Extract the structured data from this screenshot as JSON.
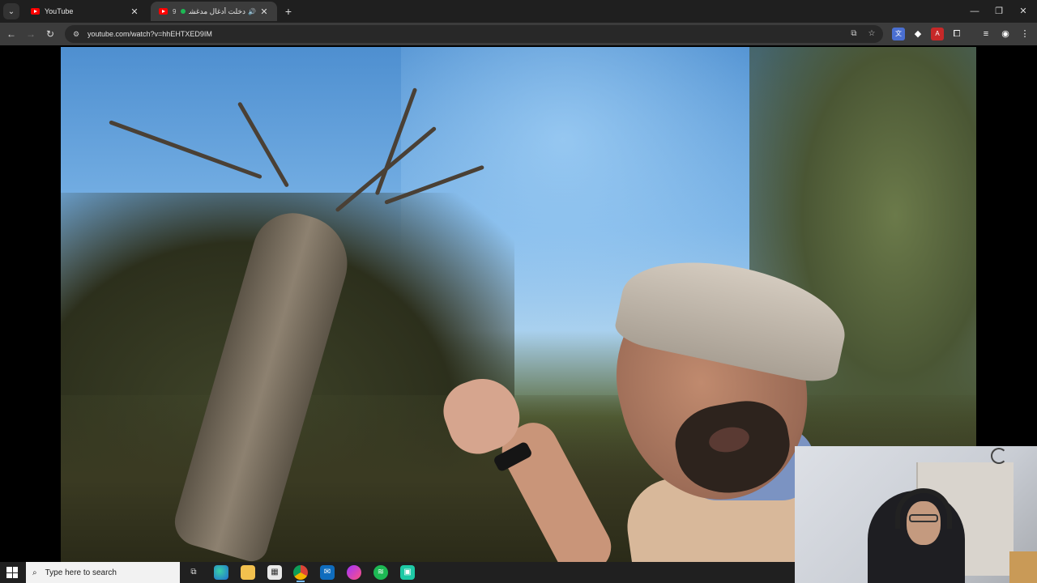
{
  "browser": {
    "tabs": [
      {
        "title": "YouTube",
        "active": false
      },
      {
        "title": "دخلت أدغال مدغشقر",
        "number": "9",
        "active": true
      }
    ],
    "address": "youtube.com/watch?v=hhEHTXED9IM",
    "icons": {
      "tab_list": "chevron-down-icon",
      "new_tab": "plus-icon",
      "back": "arrow-left-icon",
      "forward": "arrow-right-icon",
      "reload": "reload-icon",
      "site_info": "tune-icon",
      "install": "install-app-icon",
      "bookmark": "star-icon",
      "extensions": "puzzle-icon",
      "media": "media-controls-icon",
      "profile": "profile-icon",
      "menu": "kebab-menu-icon"
    }
  },
  "taskbar": {
    "search_placeholder": "Type here to search",
    "apps": [
      "task-view",
      "edge",
      "file-explorer",
      "store",
      "chrome",
      "outlook",
      "messenger",
      "spotify",
      "app"
    ]
  },
  "colors": {
    "tabbar": "#1f1f1f",
    "toolbar": "#3c3c3c",
    "youtube_red": "#ff0000",
    "taskbar": "#202020"
  }
}
